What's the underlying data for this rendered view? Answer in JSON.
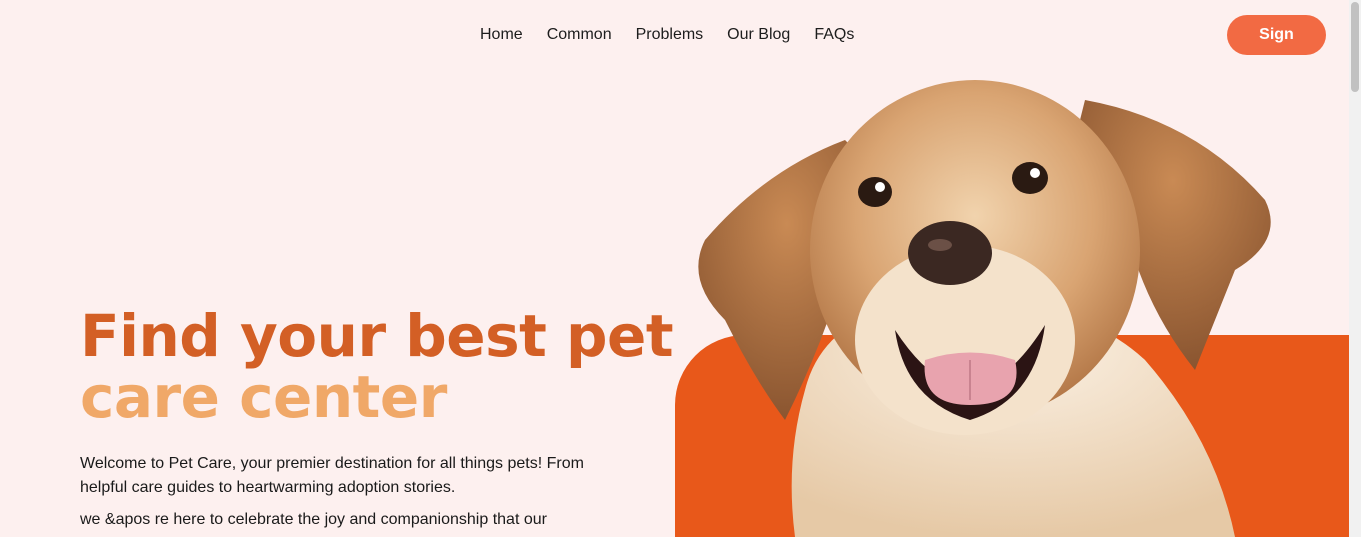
{
  "nav": {
    "links": [
      "Home",
      "Common",
      "Problems",
      "Our Blog",
      "FAQs"
    ],
    "sign_label": "Sign"
  },
  "hero": {
    "title_line1": "Find your best pet",
    "title_line2": "care center",
    "paragraph1": "Welcome to Pet Care, your premier destination for all things pets! From helpful care guides to heartwarming adoption stories.",
    "paragraph2": "we &apos re here to celebrate the joy and companionship that our",
    "image_alt": "dog-image"
  },
  "colors": {
    "accent": "#f26a43",
    "title_dark": "#d35f25",
    "title_light": "#f0a868",
    "orange_block": "#e8581a",
    "background": "#fdf0ef"
  }
}
